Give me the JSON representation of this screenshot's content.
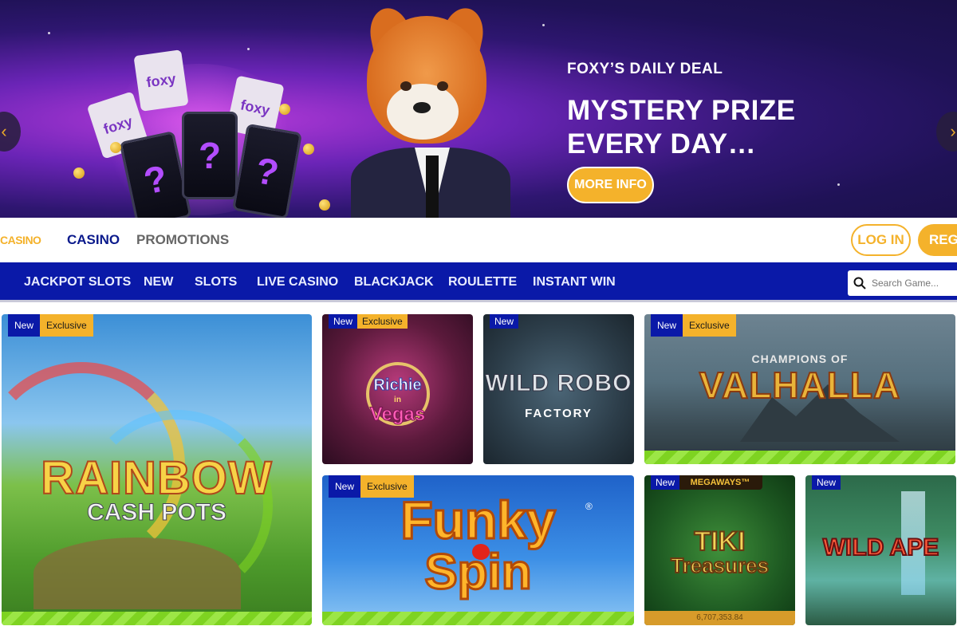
{
  "hero": {
    "kicker": "FOXY’S DAILY DEAL",
    "title_line1": "MYSTERY PRIZE",
    "title_line2": "EVERY DAY…",
    "cta_label": "MORE INFO",
    "reel_symbol": "?",
    "card_text": "foxy",
    "prev_glyph": "‹",
    "next_glyph": "›"
  },
  "header": {
    "brand_label": "CASINO",
    "nav": [
      "CASINO",
      "PROMOTIONS"
    ],
    "login_label": "LOG IN",
    "register_label": "REGI"
  },
  "categories": [
    "JACKPOT SLOTS",
    "NEW",
    "SLOTS",
    "LIVE CASINO",
    "BLACKJACK",
    "ROULETTE",
    "INSTANT WIN"
  ],
  "search": {
    "placeholder": "Search Game..."
  },
  "badges": {
    "new": "New",
    "exclusive": "Exclusive"
  },
  "games": [
    {
      "title": "RAINBOW",
      "subtitle": "CASH POTS",
      "new": true,
      "exclusive": true
    },
    {
      "title": "Richie",
      "subtitle": "Vegas",
      "connector": "in",
      "new": true,
      "exclusive": true
    },
    {
      "title": "WILD ROBO",
      "subtitle": "FACTORY",
      "new": true,
      "exclusive": false
    },
    {
      "title": "VALHALLA",
      "subtitle": "CHAMPIONS OF",
      "new": true,
      "exclusive": true
    },
    {
      "title": "Funky",
      "subtitle": "Spin",
      "trademark": "®",
      "new": true,
      "exclusive": true
    },
    {
      "title": "TIKI",
      "subtitle": "Treasures",
      "tag": "MEGAWAYS™",
      "jackpot": "6,707,353.84",
      "new": true,
      "exclusive": false
    },
    {
      "title": "WILD APE",
      "new": true,
      "exclusive": false
    }
  ],
  "colors": {
    "brand_blue": "#0a19a8",
    "accent_yellow": "#f4b22b",
    "strip_green": "#7ed321"
  }
}
